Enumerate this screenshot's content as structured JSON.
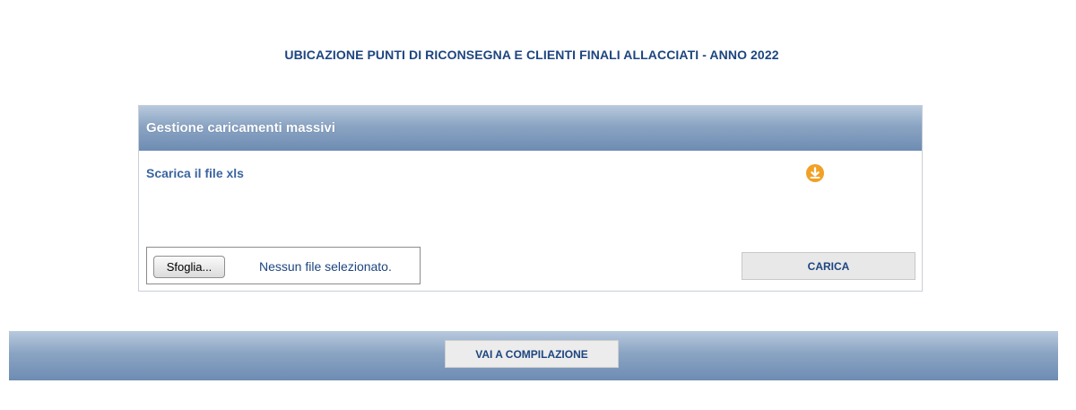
{
  "page": {
    "title": "UBICAZIONE PUNTI DI RICONSEGNA E CLIENTI FINALI ALLACCIATI - ANNO 2022"
  },
  "panel": {
    "header": "Gestione caricamenti massivi",
    "download_label": "Scarica il file xls",
    "download_icon": "download-icon",
    "browse_label": "Sfoglia...",
    "no_file_text": "Nessun file selezionato.",
    "upload_label": "CARICA"
  },
  "footer": {
    "compile_label": "VAI A COMPILAZIONE"
  },
  "colors": {
    "accent": "#1d4580",
    "header_gradient_top": "#b8c9dd",
    "header_gradient_bottom": "#6e8cb3",
    "download_icon": "#f1a125",
    "link": "#3b64a0"
  }
}
